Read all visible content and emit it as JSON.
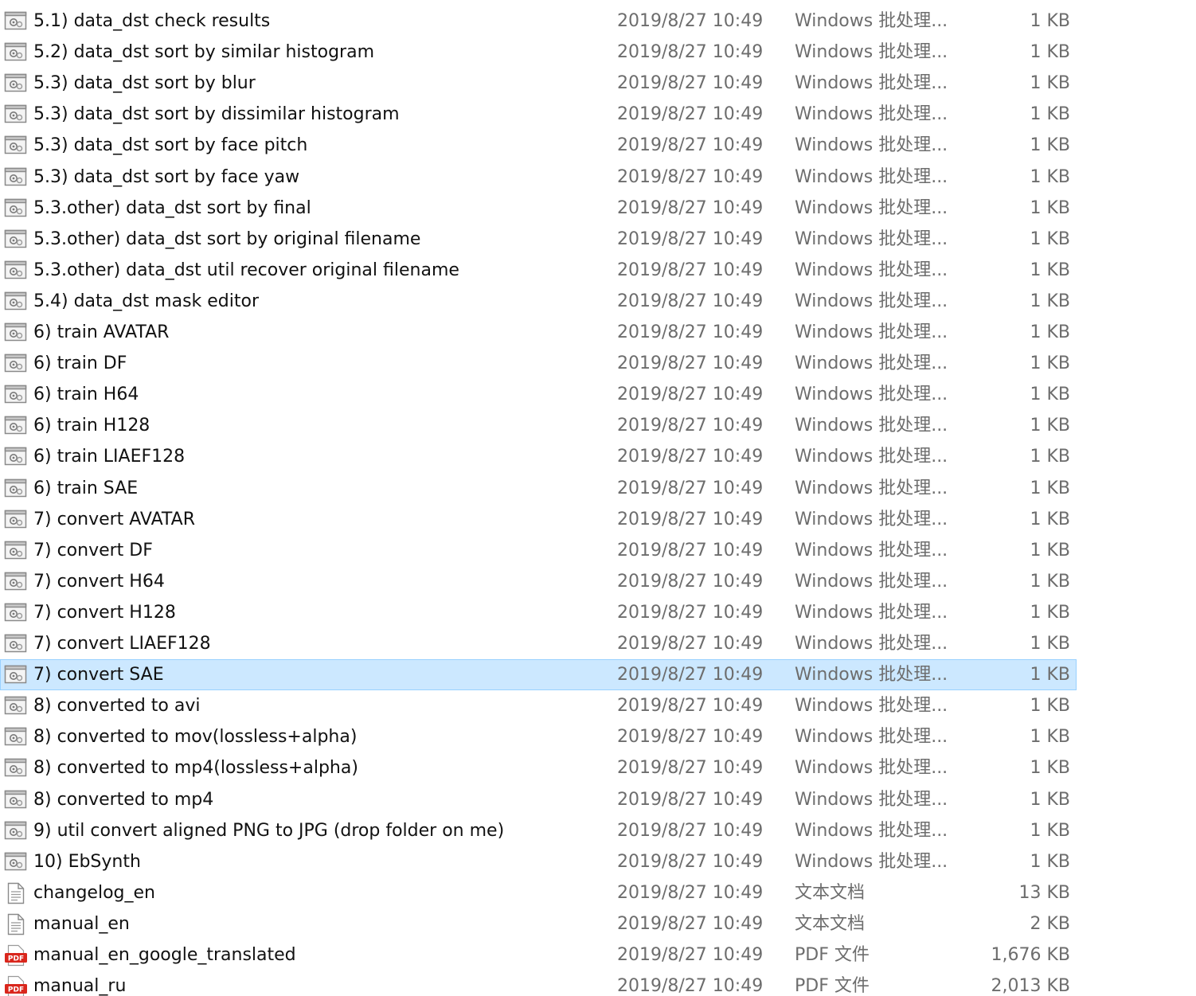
{
  "files": [
    {
      "name": "5.1) data_dst check results",
      "date": "2019/8/27 10:49",
      "type": "Windows 批处理...",
      "size": "1 KB",
      "icon": "batch-file-icon"
    },
    {
      "name": "5.2) data_dst sort by similar histogram",
      "date": "2019/8/27 10:49",
      "type": "Windows 批处理...",
      "size": "1 KB",
      "icon": "batch-file-icon"
    },
    {
      "name": "5.3) data_dst sort by blur",
      "date": "2019/8/27 10:49",
      "type": "Windows 批处理...",
      "size": "1 KB",
      "icon": "batch-file-icon"
    },
    {
      "name": "5.3) data_dst sort by dissimilar histogram",
      "date": "2019/8/27 10:49",
      "type": "Windows 批处理...",
      "size": "1 KB",
      "icon": "batch-file-icon"
    },
    {
      "name": "5.3) data_dst sort by face pitch",
      "date": "2019/8/27 10:49",
      "type": "Windows 批处理...",
      "size": "1 KB",
      "icon": "batch-file-icon"
    },
    {
      "name": "5.3) data_dst sort by face yaw",
      "date": "2019/8/27 10:49",
      "type": "Windows 批处理...",
      "size": "1 KB",
      "icon": "batch-file-icon"
    },
    {
      "name": "5.3.other) data_dst sort by final",
      "date": "2019/8/27 10:49",
      "type": "Windows 批处理...",
      "size": "1 KB",
      "icon": "batch-file-icon"
    },
    {
      "name": "5.3.other) data_dst sort by original filename",
      "date": "2019/8/27 10:49",
      "type": "Windows 批处理...",
      "size": "1 KB",
      "icon": "batch-file-icon"
    },
    {
      "name": "5.3.other) data_dst util recover original filename",
      "date": "2019/8/27 10:49",
      "type": "Windows 批处理...",
      "size": "1 KB",
      "icon": "batch-file-icon"
    },
    {
      "name": "5.4) data_dst mask editor",
      "date": "2019/8/27 10:49",
      "type": "Windows 批处理...",
      "size": "1 KB",
      "icon": "batch-file-icon"
    },
    {
      "name": "6) train AVATAR",
      "date": "2019/8/27 10:49",
      "type": "Windows 批处理...",
      "size": "1 KB",
      "icon": "batch-file-icon"
    },
    {
      "name": "6) train DF",
      "date": "2019/8/27 10:49",
      "type": "Windows 批处理...",
      "size": "1 KB",
      "icon": "batch-file-icon"
    },
    {
      "name": "6) train H64",
      "date": "2019/8/27 10:49",
      "type": "Windows 批处理...",
      "size": "1 KB",
      "icon": "batch-file-icon"
    },
    {
      "name": "6) train H128",
      "date": "2019/8/27 10:49",
      "type": "Windows 批处理...",
      "size": "1 KB",
      "icon": "batch-file-icon"
    },
    {
      "name": "6) train LIAEF128",
      "date": "2019/8/27 10:49",
      "type": "Windows 批处理...",
      "size": "1 KB",
      "icon": "batch-file-icon"
    },
    {
      "name": "6) train SAE",
      "date": "2019/8/27 10:49",
      "type": "Windows 批处理...",
      "size": "1 KB",
      "icon": "batch-file-icon"
    },
    {
      "name": "7) convert AVATAR",
      "date": "2019/8/27 10:49",
      "type": "Windows 批处理...",
      "size": "1 KB",
      "icon": "batch-file-icon"
    },
    {
      "name": "7) convert DF",
      "date": "2019/8/27 10:49",
      "type": "Windows 批处理...",
      "size": "1 KB",
      "icon": "batch-file-icon"
    },
    {
      "name": "7) convert H64",
      "date": "2019/8/27 10:49",
      "type": "Windows 批处理...",
      "size": "1 KB",
      "icon": "batch-file-icon"
    },
    {
      "name": "7) convert H128",
      "date": "2019/8/27 10:49",
      "type": "Windows 批处理...",
      "size": "1 KB",
      "icon": "batch-file-icon"
    },
    {
      "name": "7) convert LIAEF128",
      "date": "2019/8/27 10:49",
      "type": "Windows 批处理...",
      "size": "1 KB",
      "icon": "batch-file-icon"
    },
    {
      "name": "7) convert SAE",
      "date": "2019/8/27 10:49",
      "type": "Windows 批处理...",
      "size": "1 KB",
      "icon": "batch-file-icon",
      "selected": true
    },
    {
      "name": "8) converted to avi",
      "date": "2019/8/27 10:49",
      "type": "Windows 批处理...",
      "size": "1 KB",
      "icon": "batch-file-icon"
    },
    {
      "name": "8) converted to mov(lossless+alpha)",
      "date": "2019/8/27 10:49",
      "type": "Windows 批处理...",
      "size": "1 KB",
      "icon": "batch-file-icon"
    },
    {
      "name": "8) converted to mp4(lossless+alpha)",
      "date": "2019/8/27 10:49",
      "type": "Windows 批处理...",
      "size": "1 KB",
      "icon": "batch-file-icon"
    },
    {
      "name": "8) converted to mp4",
      "date": "2019/8/27 10:49",
      "type": "Windows 批处理...",
      "size": "1 KB",
      "icon": "batch-file-icon"
    },
    {
      "name": "9) util convert aligned PNG to JPG (drop folder on me)",
      "date": "2019/8/27 10:49",
      "type": "Windows 批处理...",
      "size": "1 KB",
      "icon": "batch-file-icon"
    },
    {
      "name": "10) EbSynth",
      "date": "2019/8/27 10:49",
      "type": "Windows 批处理...",
      "size": "1 KB",
      "icon": "batch-file-icon"
    },
    {
      "name": "changelog_en",
      "date": "2019/8/27 10:49",
      "type": "文本文档",
      "size": "13 KB",
      "icon": "text-document-icon"
    },
    {
      "name": "manual_en",
      "date": "2019/8/27 10:49",
      "type": "文本文档",
      "size": "2 KB",
      "icon": "text-document-icon"
    },
    {
      "name": "manual_en_google_translated",
      "date": "2019/8/27 10:49",
      "type": "PDF 文件",
      "size": "1,676 KB",
      "icon": "pdf-file-icon"
    },
    {
      "name": "manual_ru",
      "date": "2019/8/27 10:49",
      "type": "PDF 文件",
      "size": "2,013 KB",
      "icon": "pdf-file-icon"
    }
  ]
}
